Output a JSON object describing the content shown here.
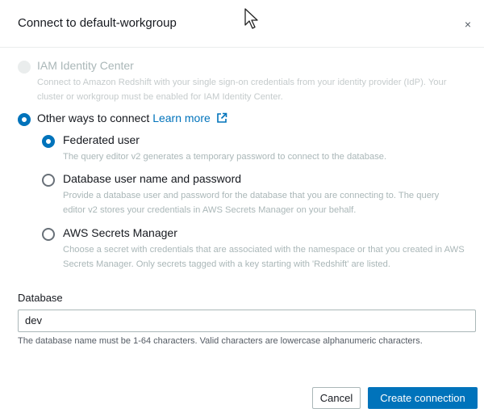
{
  "dialog": {
    "title": "Connect to default-workgroup",
    "close_symbol": "×"
  },
  "options": {
    "iam": {
      "label": "IAM Identity Center",
      "description": "Connect to Amazon Redshift with your single sign-on credentials from your identity provider (IdP). Your cluster or workgroup must be enabled for IAM Identity Center.",
      "disabled": true,
      "selected": false
    },
    "other": {
      "label": "Other ways to connect",
      "link": "Learn more",
      "selected": true
    },
    "federated": {
      "label": "Federated user",
      "description": "The query editor v2 generates a temporary password to connect to the database.",
      "selected": true
    },
    "dbuser": {
      "label": "Database user name and password",
      "description": "Provide a database user and password for the database that you are connecting to. The query editor v2 stores your credentials in AWS Secrets Manager on your behalf.",
      "selected": false
    },
    "secrets": {
      "label": "AWS Secrets Manager",
      "description": "Choose a secret with credentials that are associated with the namespace or that you created in AWS Secrets Manager. Only secrets tagged with a key starting with 'Redshift' are listed.",
      "selected": false
    }
  },
  "database": {
    "label": "Database",
    "value": "dev",
    "hint": "The database name must be 1-64 characters. Valid characters are lowercase alphanumeric characters."
  },
  "footer": {
    "cancel_label": "Cancel",
    "create_label": "Create connection"
  },
  "colors": {
    "primary": "#0073bb",
    "text": "#16191f",
    "muted": "#aab7b8"
  }
}
